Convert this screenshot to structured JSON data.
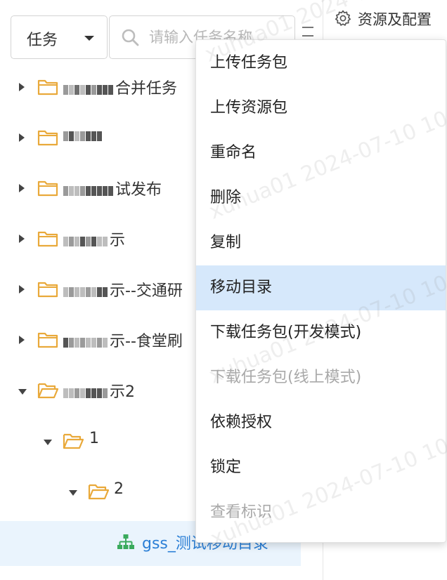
{
  "header": {
    "type_select": "任务",
    "search_placeholder": "请输入任务名称",
    "resource_config": "资源及配置"
  },
  "tree": {
    "rows": [
      {
        "label": "合并任务",
        "state": "collapsed"
      },
      {
        "label": "",
        "state": "collapsed"
      },
      {
        "label": "试发布",
        "state": "collapsed"
      },
      {
        "label": "示",
        "state": "collapsed"
      },
      {
        "label": "示--交通研",
        "state": "collapsed"
      },
      {
        "label": "示--食堂刷",
        "state": "collapsed"
      },
      {
        "label": "示2",
        "state": "expanded"
      },
      {
        "label": "1",
        "state": "expanded"
      },
      {
        "label": "2",
        "state": "expanded"
      },
      {
        "label": "gss_测试移动目录",
        "state": "selected"
      }
    ]
  },
  "context_menu": {
    "items": [
      {
        "label": "上传任务包",
        "state": "normal"
      },
      {
        "label": "上传资源包",
        "state": "normal"
      },
      {
        "label": "重命名",
        "state": "normal"
      },
      {
        "label": "删除",
        "state": "normal"
      },
      {
        "label": "复制",
        "state": "normal"
      },
      {
        "label": "移动目录",
        "state": "active"
      },
      {
        "label": "下载任务包(开发模式)",
        "state": "normal"
      },
      {
        "label": "下载任务包(线上模式)",
        "state": "disabled"
      },
      {
        "label": "依赖授权",
        "state": "normal"
      },
      {
        "label": "锁定",
        "state": "normal"
      },
      {
        "label": "查看标识",
        "state": "disabled"
      }
    ]
  },
  "watermark": {
    "text": "xuhua01 2024-07-10 10"
  },
  "colors": {
    "folder": "#e9a93a",
    "selected_row_bg": "#eaf4fd",
    "menu_active_bg": "#d6e8fb",
    "task_icon": "#3aaa5c",
    "task_text": "#2b7fd6",
    "disabled_text": "#a9a9a9"
  }
}
